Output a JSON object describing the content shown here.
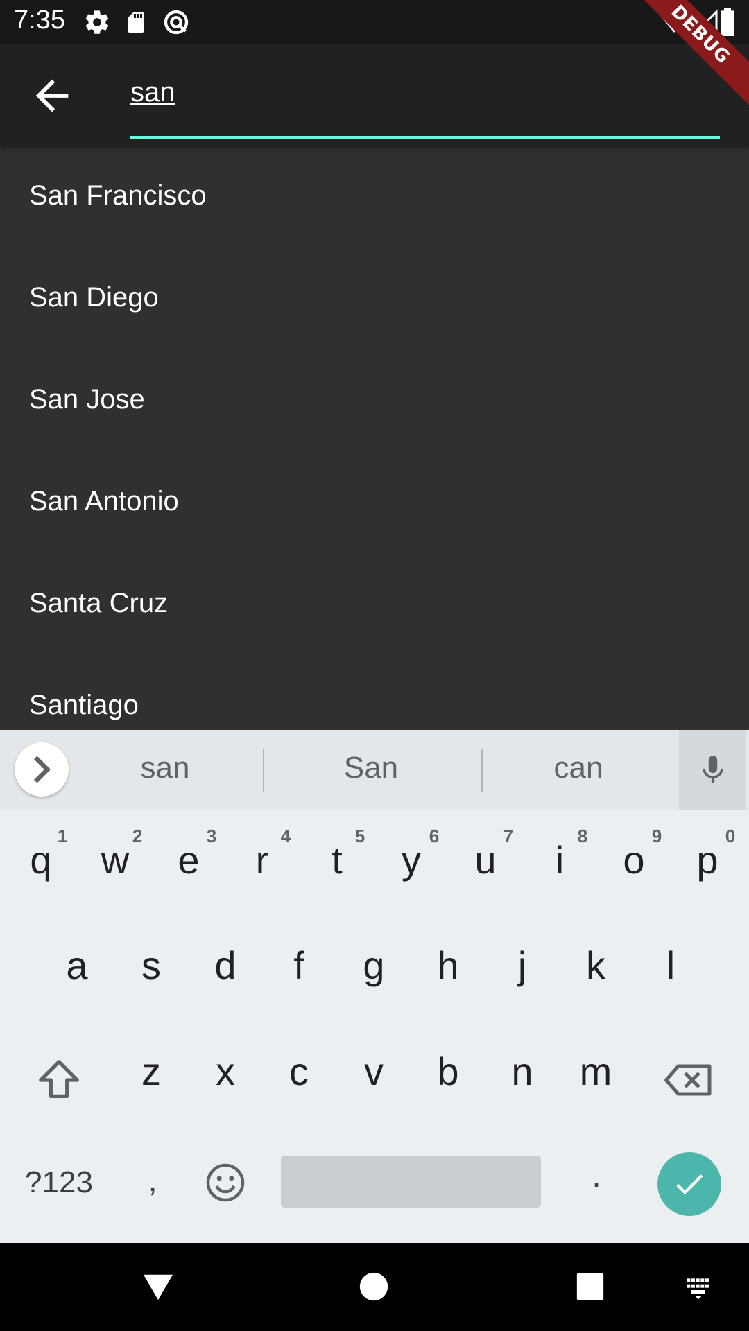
{
  "status_bar": {
    "time": "7:35",
    "icons": [
      "settings-icon",
      "sd-card-icon",
      "sync-icon",
      "wifi-icon",
      "signal-icon",
      "battery-icon"
    ]
  },
  "debug_banner": "DEBUG",
  "search": {
    "value": "san",
    "accent_color": "#64ffda"
  },
  "results": [
    {
      "label": "San Francisco"
    },
    {
      "label": "San Diego"
    },
    {
      "label": "San Jose"
    },
    {
      "label": "San Antonio"
    },
    {
      "label": "Santa Cruz"
    },
    {
      "label": "Santiago"
    }
  ],
  "keyboard": {
    "suggestions": [
      "san",
      "San",
      "can"
    ],
    "row1": [
      "q",
      "w",
      "e",
      "r",
      "t",
      "y",
      "u",
      "i",
      "o",
      "p"
    ],
    "row1_hints": [
      "1",
      "2",
      "3",
      "4",
      "5",
      "6",
      "7",
      "8",
      "9",
      "0"
    ],
    "row2": [
      "a",
      "s",
      "d",
      "f",
      "g",
      "h",
      "j",
      "k",
      "l"
    ],
    "row3": [
      "z",
      "x",
      "c",
      "v",
      "b",
      "n",
      "m"
    ],
    "symbols_label": "?123",
    "comma": ",",
    "period": ".",
    "enter_color": "#4db6ac"
  }
}
